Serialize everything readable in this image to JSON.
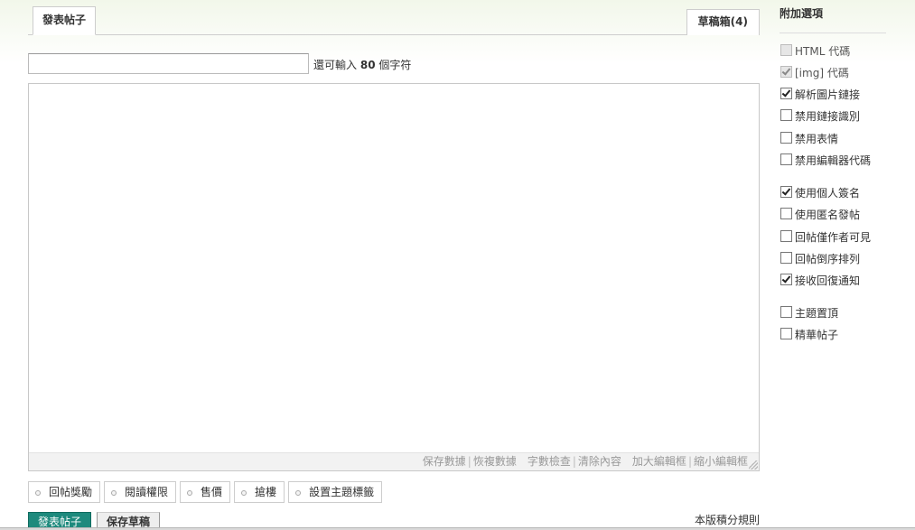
{
  "tabs": {
    "post_label": "發表帖子",
    "draft_label": "草稿箱(4)"
  },
  "subject": {
    "value": "",
    "placeholder": "",
    "remaining_prefix": "還可輸入",
    "remaining_count": "80",
    "remaining_suffix": "個字符"
  },
  "editor": {
    "content": "",
    "toolbar": {
      "save_data": "保存數據",
      "restore_data": "恢複數據",
      "char_check": "字數檢查",
      "clear_content": "清除內容",
      "enlarge": "加大編輯框",
      "shrink": "縮小編輯框"
    }
  },
  "extras": {
    "items": [
      {
        "label": "回帖獎勵"
      },
      {
        "label": "閱讀權限"
      },
      {
        "label": "售價"
      },
      {
        "label": "搶樓"
      },
      {
        "label": "設置主題標籤"
      }
    ]
  },
  "actions": {
    "post_label": "發表帖子",
    "save_draft_label": "保存草稿",
    "rules_label": "本版積分規則"
  },
  "sidebar": {
    "title": "附加選項",
    "options": [
      {
        "label": "HTML 代碼",
        "checked": false,
        "disabled": true
      },
      {
        "label": "[img] 代碼",
        "checked": true,
        "disabled": true
      },
      {
        "label": "解析圖片鏈接",
        "checked": true,
        "disabled": false
      },
      {
        "label": "禁用鏈接識別",
        "checked": false,
        "disabled": false
      },
      {
        "label": "禁用表情",
        "checked": false,
        "disabled": false
      },
      {
        "label": "禁用編輯器代碼",
        "checked": false,
        "disabled": false
      },
      {
        "label": "使用個人簽名",
        "checked": true,
        "disabled": false
      },
      {
        "label": "使用匿名發帖",
        "checked": false,
        "disabled": false
      },
      {
        "label": "回帖僅作者可見",
        "checked": false,
        "disabled": false
      },
      {
        "label": "回帖倒序排列",
        "checked": false,
        "disabled": false
      },
      {
        "label": "接收回復通知",
        "checked": true,
        "disabled": false
      },
      {
        "label": "主題置頂",
        "checked": false,
        "disabled": false
      },
      {
        "label": "精華帖子",
        "checked": false,
        "disabled": false
      }
    ]
  }
}
